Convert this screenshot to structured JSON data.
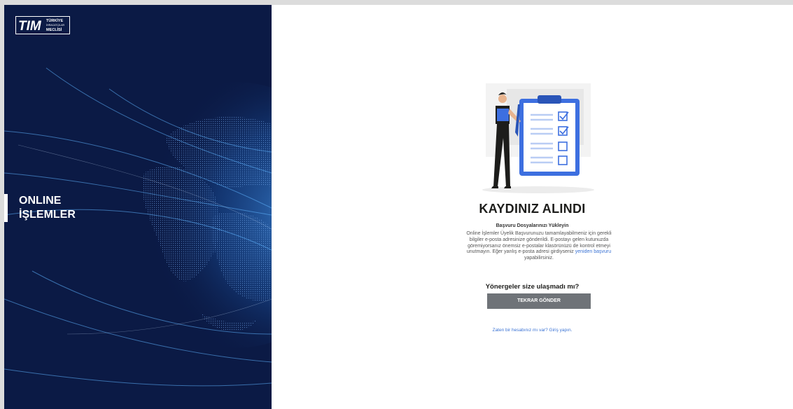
{
  "brand": {
    "logo_mark": "TIM",
    "logo_line1": "TÜRKİYE",
    "logo_line2": "İHRACATÇILAR",
    "logo_line3": "MECLİSİ"
  },
  "sidebar": {
    "title_line1": "ONLINE",
    "title_line2": "İŞLEMLER"
  },
  "confirmation": {
    "heading": "KAYDINIZ ALINDI",
    "subheading": "Başvuru Dosyalarınızı Yükleyin",
    "description_before_link": "Online İşlemler Üyelik Başvurunuzu tamamlayabilmeniz için gerekli bilgiler e-posta adresinize gönderildi. E-postayı gelen kutunuzda göremiyorsanız önemsiz e-postalar klasörünüzü de kontrol etmeyi unutmayın. Eğer yanlış e-posta adresi girdiyseniz",
    "description_link": "yeniden başvuru",
    "description_after_link": "yapabilirsiniz.",
    "question": "Yönergeler size ulaşmadı mı?",
    "resend_button": "TEKRAR GÖNDER",
    "login_link": "Zaten bir hesabınız mı var? Giriş yapın."
  },
  "colors": {
    "sidebar_bg": "#0b1a45",
    "button_bg": "#6f7378",
    "link": "#3b73d4",
    "illustration_accent": "#3d6fe0"
  }
}
